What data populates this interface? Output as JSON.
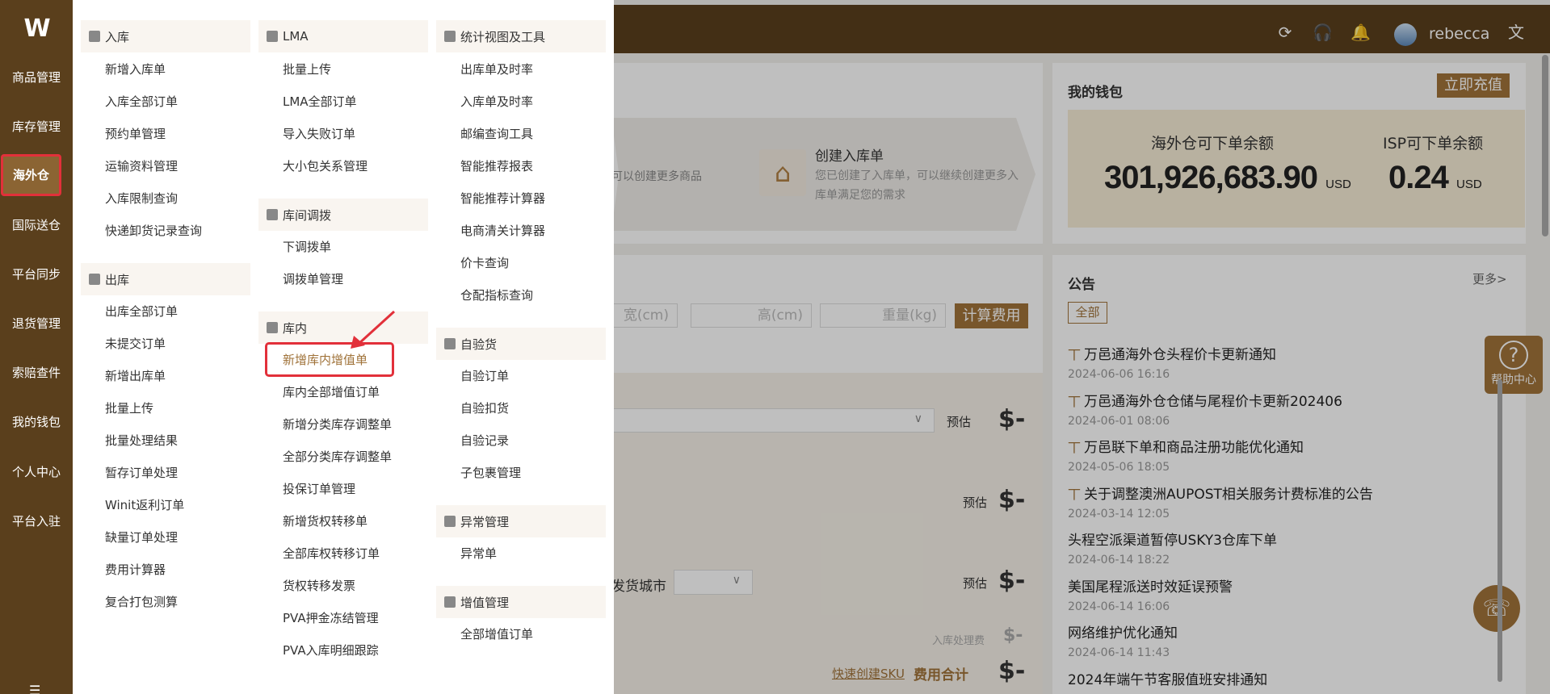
{
  "topbar": {
    "icons": [
      "refresh-icon",
      "headset-icon",
      "bell-icon",
      "translate-icon"
    ],
    "username": "rebecca"
  },
  "sidebar": {
    "logo": "W",
    "items": [
      {
        "label": "商品管理"
      },
      {
        "label": "库存管理"
      },
      {
        "label": "海外仓",
        "active": true
      },
      {
        "label": "国际送仓"
      },
      {
        "label": "平台同步"
      },
      {
        "label": "退货管理"
      },
      {
        "label": "索赔查件"
      },
      {
        "label": "我的钱包"
      },
      {
        "label": "个人中心"
      },
      {
        "label": "平台入驻"
      }
    ]
  },
  "mega_menu": {
    "col1": {
      "inbound": {
        "title": "入库",
        "items": [
          "新增入库单",
          "入库全部订单",
          "预约单管理",
          "运输资料管理",
          "入库限制查询",
          "快递卸货记录查询"
        ]
      },
      "outbound": {
        "title": "出库",
        "items": [
          "出库全部订单",
          "未提交订单",
          "新增出库单",
          "批量上传",
          "批量处理结果",
          "暂存订单处理",
          "Winit返利订单",
          "缺量订单处理",
          "费用计算器",
          "复合打包测算"
        ]
      }
    },
    "col2": {
      "lma": {
        "title": "LMA",
        "items": [
          "批量上传",
          "LMA全部订单",
          "导入失败订单",
          "大小包关系管理"
        ]
      },
      "transfer": {
        "title": "库间调拨",
        "items": [
          "下调拨单",
          "调拨单管理"
        ]
      },
      "in_warehouse": {
        "title": "库内",
        "items": [
          "新增库内增值单",
          "库内全部增值订单",
          "新增分类库存调整单",
          "全部分类库存调整单",
          "投保订单管理",
          "新增货权转移单",
          "全部库权转移订单",
          "货权转移发票",
          "PVA押金冻结管理",
          "PVA入库明细跟踪"
        ]
      }
    },
    "col3": {
      "stats": {
        "title": "统计视图及工具",
        "items": [
          "出库单及时率",
          "入库单及时率",
          "邮编查询工具",
          "智能推荐报表",
          "智能推荐计算器",
          "电商清关计算器",
          "价卡查询",
          "仓配指标查询"
        ]
      },
      "self_check": {
        "title": "自验货",
        "items": [
          "自验订单",
          "自验扣货",
          "自验记录",
          "子包裹管理"
        ]
      },
      "exception": {
        "title": "异常管理",
        "items": [
          "异常单"
        ]
      },
      "value_added": {
        "title": "增值管理",
        "items": [
          "全部增值订单"
        ]
      }
    }
  },
  "steps": {
    "step1_text": "可以创建更多商品",
    "step2_title": "创建入库单",
    "step2_desc": "您已创建了入库单，可以继续创建更多入库单满足您的需求"
  },
  "calculator": {
    "width_placeholder": "宽(cm)",
    "height_placeholder": "高(cm)",
    "weight_placeholder": "重量(kg)",
    "calc_button": "计算费用",
    "estimate": "预估",
    "dollar": "$-",
    "ship_city": "发货城市",
    "inbound_fee": "入库处理费",
    "quick_sku": "快速创建SKU",
    "total": "费用合计"
  },
  "wallet": {
    "title": "我的钱包",
    "recharge": "立即充值",
    "overseas_label": "海外仓可下单余额",
    "overseas_value": "301,926,683.90",
    "isp_label": "ISP可下单余额",
    "isp_value": "0.24",
    "currency": "USD"
  },
  "notices": {
    "title": "公告",
    "more": "更多>",
    "tag_all": "全部",
    "items": [
      {
        "title": "万邑通海外仓头程价卡更新通知",
        "date": "2024-06-06 16:16",
        "pinned": true
      },
      {
        "title": "万邑通海外仓仓储与尾程价卡更新202406",
        "date": "2024-06-01 08:06",
        "pinned": true
      },
      {
        "title": "万邑联下单和商品注册功能优化通知",
        "date": "2024-05-06 18:05",
        "pinned": true
      },
      {
        "title": "关于调整澳洲AUPOST相关服务计费标准的公告",
        "date": "2024-03-14 12:05",
        "pinned": true
      },
      {
        "title": "头程空派渠道暂停USKY3仓库下单",
        "date": "2024-06-14 18:22",
        "pinned": false
      },
      {
        "title": "美国尾程派送时效延误预警",
        "date": "2024-06-14 16:06",
        "pinned": false
      },
      {
        "title": "网络维护优化通知",
        "date": "2024-06-14 11:43",
        "pinned": false
      },
      {
        "title": "2024年端午节客服值班安排通知",
        "date": "",
        "pinned": false
      }
    ]
  },
  "help": {
    "label": "帮助中心"
  },
  "colors": {
    "brand": "#5a3f1c",
    "accent": "#a0733a",
    "highlight": "#e2303a"
  }
}
